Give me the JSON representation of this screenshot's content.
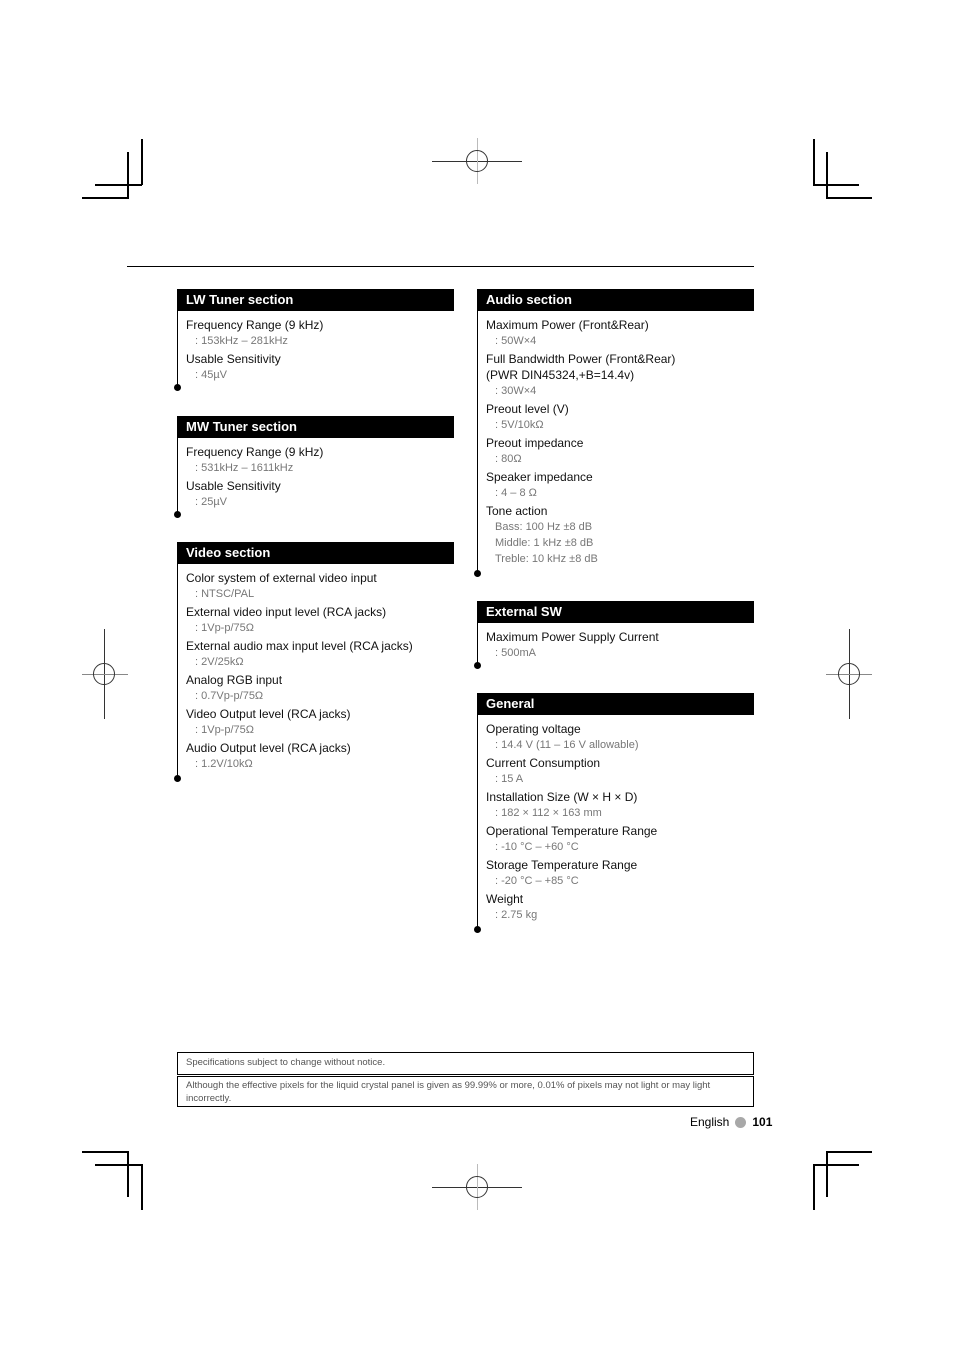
{
  "sections": {
    "lw": {
      "title": "LW Tuner section",
      "specs": [
        {
          "label": "Frequency Range (9 kHz)",
          "values": [
            ": 153kHz – 281kHz"
          ]
        },
        {
          "label": "Usable Sensitivity",
          "values": [
            ": 45µV"
          ]
        }
      ]
    },
    "mw": {
      "title": "MW Tuner section",
      "specs": [
        {
          "label": "Frequency Range (9 kHz)",
          "values": [
            ": 531kHz – 1611kHz"
          ]
        },
        {
          "label": "Usable Sensitivity",
          "values": [
            ": 25µV"
          ]
        }
      ]
    },
    "video": {
      "title": "Video section",
      "specs": [
        {
          "label": "Color system of external video input",
          "values": [
            ": NTSC/PAL"
          ]
        },
        {
          "label": "External video input level (RCA jacks)",
          "values": [
            ": 1Vp-p/75Ω"
          ]
        },
        {
          "label": "External audio max input level (RCA jacks)",
          "values": [
            ": 2V/25kΩ"
          ]
        },
        {
          "label": "Analog RGB input",
          "values": [
            ": 0.7Vp-p/75Ω"
          ]
        },
        {
          "label": "Video Output level (RCA jacks)",
          "values": [
            ": 1Vp-p/75Ω"
          ]
        },
        {
          "label": "Audio Output level (RCA jacks)",
          "values": [
            ": 1.2V/10kΩ"
          ]
        }
      ]
    },
    "audio": {
      "title": "Audio section",
      "specs": [
        {
          "label": "Maximum Power (Front&Rear)",
          "values": [
            ": 50W×4"
          ]
        },
        {
          "label": "Full Bandwidth Power (Front&Rear)",
          "label2": "(PWR DIN45324,+B=14.4v)",
          "values": [
            ": 30W×4"
          ]
        },
        {
          "label": "Preout level (V)",
          "values": [
            ": 5V/10kΩ"
          ]
        },
        {
          "label": "Preout impedance",
          "values": [
            ": 80Ω"
          ]
        },
        {
          "label": "Speaker impedance",
          "values": [
            ": 4 – 8 Ω"
          ]
        },
        {
          "label": "Tone action",
          "values": [
            "Bass: 100 Hz ±8 dB",
            "Middle: 1 kHz ±8 dB",
            "Treble: 10 kHz ±8 dB"
          ]
        }
      ]
    },
    "extsw": {
      "title": "External SW",
      "specs": [
        {
          "label": "Maximum Power Supply Current",
          "values": [
            ": 500mA"
          ]
        }
      ]
    },
    "general": {
      "title": "General",
      "specs": [
        {
          "label": "Operating voltage",
          "values": [
            ": 14.4 V (11 – 16 V allowable)"
          ]
        },
        {
          "label": "Current Consumption",
          "values": [
            ": 15 A"
          ]
        },
        {
          "label": "Installation Size  (W × H × D)",
          "values": [
            ": 182 × 112 × 163 mm"
          ]
        },
        {
          "label": "Operational Temperature Range",
          "values": [
            ": -10 °C – +60 °C"
          ]
        },
        {
          "label": "Storage Temperature Range",
          "values": [
            ": -20 °C – +85 °C"
          ]
        },
        {
          "label": "Weight",
          "values": [
            ": 2.75 kg"
          ]
        }
      ]
    }
  },
  "notices": {
    "spec_change": "Specifications subject to change without notice.",
    "lcd_pixels": "Although the effective pixels for the liquid crystal panel is given as 99.99% or more, 0.01% of pixels may not light or may light incorrectly."
  },
  "footer": {
    "language": "English",
    "page_number": "101"
  }
}
